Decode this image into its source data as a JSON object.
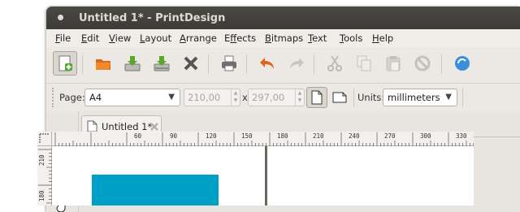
{
  "window": {
    "title": "Untitled 1* - PrintDesign"
  },
  "menu": [
    "File",
    "Edit",
    "View",
    "Layout",
    "Arrange",
    "Effects",
    "Bitmaps",
    "Text",
    "Tools",
    "Help"
  ],
  "menu_mnemonics": [
    "F",
    "E",
    "V",
    "L",
    "A",
    "f",
    "B",
    "T",
    "T",
    "H"
  ],
  "toolbar": {
    "buttons": [
      "new-document",
      "open",
      "save",
      "save-as",
      "close",
      "print",
      "undo",
      "redo",
      "cut",
      "copy",
      "paste",
      "delete",
      "refresh"
    ]
  },
  "page_props": {
    "page_label": "Page:",
    "page_size": "A4",
    "width": "210,00",
    "height": "297,00",
    "times": "x",
    "units_label": "Units:",
    "units": "millimeters"
  },
  "tabs": [
    {
      "label": "Untitled 1*"
    }
  ],
  "ruler": {
    "h_labels": [
      "60",
      "90",
      "120",
      "150",
      "180",
      "210",
      "240",
      "270",
      "300",
      "330"
    ],
    "v_labels": [
      "210",
      "180"
    ]
  },
  "colors": {
    "shape_fill": "#00a0c6",
    "title_bar": "#3c3b37"
  }
}
